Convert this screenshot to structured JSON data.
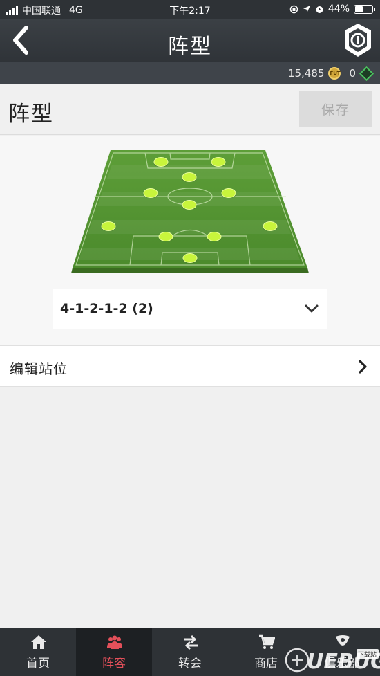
{
  "status_bar": {
    "carrier": "中国联通",
    "network": "4G",
    "time": "下午2:17",
    "battery": "44%",
    "battery_level": 0.44
  },
  "header": {
    "title": "阵型",
    "back_icon": "chevron-left-icon",
    "logo_icon": "club-badge-icon"
  },
  "currency": {
    "coins": "15,485",
    "coin_badge": "FUT",
    "points": "0"
  },
  "page": {
    "title": "阵型",
    "save_label": "保存"
  },
  "formation": {
    "selected": "4-1-2-1-2 (2)",
    "player_count": 11
  },
  "edit_positions": {
    "label": "编辑站位"
  },
  "bottom_nav": {
    "items": [
      {
        "label": "首页",
        "icon": "home-icon"
      },
      {
        "label": "阵容",
        "icon": "squad-icon",
        "active": true
      },
      {
        "label": "转会",
        "icon": "transfer-arrows-icon"
      },
      {
        "label": "商店",
        "icon": "cart-icon"
      },
      {
        "label": "俱乐部",
        "icon": "club-icon"
      }
    ]
  },
  "watermark": {
    "text": "UEBUG",
    "subtext": "下载站"
  },
  "colors": {
    "header_bg": "#2e3236",
    "active_nav": "#e3505a",
    "pitch_green": "#5a9a34",
    "player_dot": "#c8f53c"
  }
}
